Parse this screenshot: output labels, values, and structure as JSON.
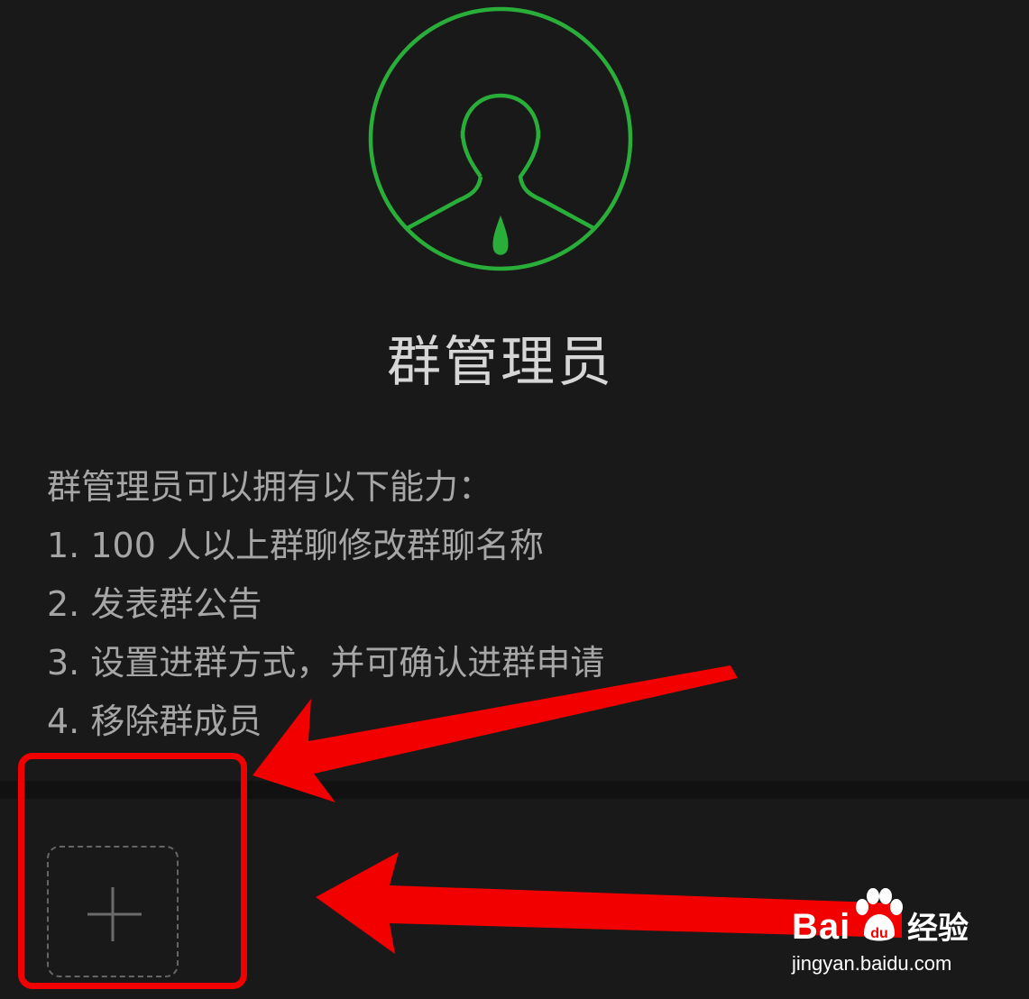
{
  "colors": {
    "background": "#191919",
    "divider": "#111111",
    "accent_green": "#2aae3a",
    "title_text": "#d6d6d6",
    "body_text": "#a6a6a6",
    "annotation_red": "#f20000"
  },
  "header": {
    "icon": "group-admin-icon",
    "title": "群管理员"
  },
  "description": {
    "intro": "群管理员可以拥有以下能力：",
    "items": [
      "1. 100 人以上群聊修改群聊名称",
      "2. 发表群公告",
      "3. 设置进群方式，并可确认进群申请",
      "4. 移除群成员"
    ]
  },
  "members": {
    "add_icon": "plus-icon"
  },
  "annotations": {
    "highlight": "red-highlight-box",
    "arrow_icon": "red-arrow-icon"
  },
  "watermark": {
    "brand_prefix": "Bai",
    "brand_suffix": "经验",
    "url": "jingyan.baidu.com",
    "icon": "paw-icon"
  }
}
